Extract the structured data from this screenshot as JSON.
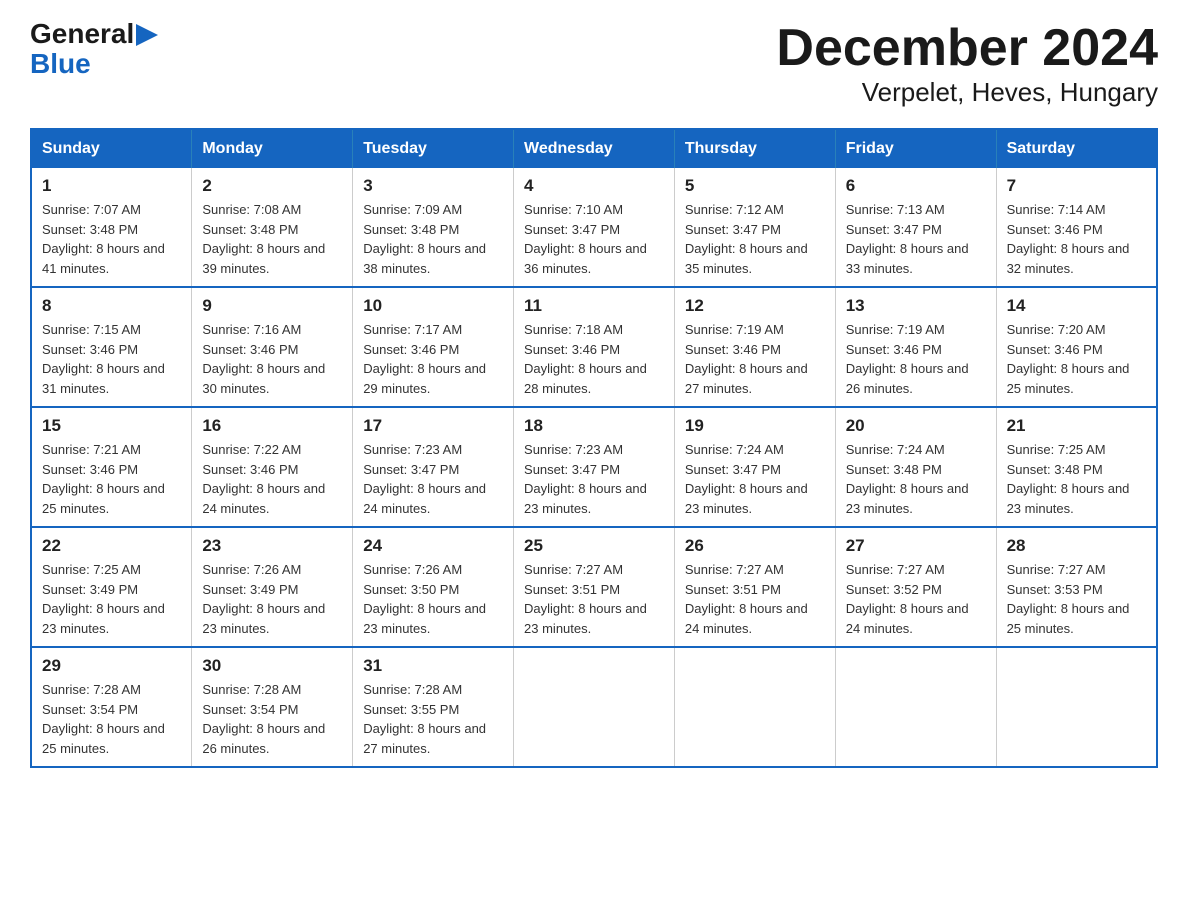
{
  "logo": {
    "general": "General",
    "arrow": "▶",
    "blue": "Blue"
  },
  "title": "December 2024",
  "subtitle": "Verpelet, Heves, Hungary",
  "weekdays": [
    "Sunday",
    "Monday",
    "Tuesday",
    "Wednesday",
    "Thursday",
    "Friday",
    "Saturday"
  ],
  "weeks": [
    [
      {
        "day": "1",
        "sunrise": "Sunrise: 7:07 AM",
        "sunset": "Sunset: 3:48 PM",
        "daylight": "Daylight: 8 hours and 41 minutes."
      },
      {
        "day": "2",
        "sunrise": "Sunrise: 7:08 AM",
        "sunset": "Sunset: 3:48 PM",
        "daylight": "Daylight: 8 hours and 39 minutes."
      },
      {
        "day": "3",
        "sunrise": "Sunrise: 7:09 AM",
        "sunset": "Sunset: 3:48 PM",
        "daylight": "Daylight: 8 hours and 38 minutes."
      },
      {
        "day": "4",
        "sunrise": "Sunrise: 7:10 AM",
        "sunset": "Sunset: 3:47 PM",
        "daylight": "Daylight: 8 hours and 36 minutes."
      },
      {
        "day": "5",
        "sunrise": "Sunrise: 7:12 AM",
        "sunset": "Sunset: 3:47 PM",
        "daylight": "Daylight: 8 hours and 35 minutes."
      },
      {
        "day": "6",
        "sunrise": "Sunrise: 7:13 AM",
        "sunset": "Sunset: 3:47 PM",
        "daylight": "Daylight: 8 hours and 33 minutes."
      },
      {
        "day": "7",
        "sunrise": "Sunrise: 7:14 AM",
        "sunset": "Sunset: 3:46 PM",
        "daylight": "Daylight: 8 hours and 32 minutes."
      }
    ],
    [
      {
        "day": "8",
        "sunrise": "Sunrise: 7:15 AM",
        "sunset": "Sunset: 3:46 PM",
        "daylight": "Daylight: 8 hours and 31 minutes."
      },
      {
        "day": "9",
        "sunrise": "Sunrise: 7:16 AM",
        "sunset": "Sunset: 3:46 PM",
        "daylight": "Daylight: 8 hours and 30 minutes."
      },
      {
        "day": "10",
        "sunrise": "Sunrise: 7:17 AM",
        "sunset": "Sunset: 3:46 PM",
        "daylight": "Daylight: 8 hours and 29 minutes."
      },
      {
        "day": "11",
        "sunrise": "Sunrise: 7:18 AM",
        "sunset": "Sunset: 3:46 PM",
        "daylight": "Daylight: 8 hours and 28 minutes."
      },
      {
        "day": "12",
        "sunrise": "Sunrise: 7:19 AM",
        "sunset": "Sunset: 3:46 PM",
        "daylight": "Daylight: 8 hours and 27 minutes."
      },
      {
        "day": "13",
        "sunrise": "Sunrise: 7:19 AM",
        "sunset": "Sunset: 3:46 PM",
        "daylight": "Daylight: 8 hours and 26 minutes."
      },
      {
        "day": "14",
        "sunrise": "Sunrise: 7:20 AM",
        "sunset": "Sunset: 3:46 PM",
        "daylight": "Daylight: 8 hours and 25 minutes."
      }
    ],
    [
      {
        "day": "15",
        "sunrise": "Sunrise: 7:21 AM",
        "sunset": "Sunset: 3:46 PM",
        "daylight": "Daylight: 8 hours and 25 minutes."
      },
      {
        "day": "16",
        "sunrise": "Sunrise: 7:22 AM",
        "sunset": "Sunset: 3:46 PM",
        "daylight": "Daylight: 8 hours and 24 minutes."
      },
      {
        "day": "17",
        "sunrise": "Sunrise: 7:23 AM",
        "sunset": "Sunset: 3:47 PM",
        "daylight": "Daylight: 8 hours and 24 minutes."
      },
      {
        "day": "18",
        "sunrise": "Sunrise: 7:23 AM",
        "sunset": "Sunset: 3:47 PM",
        "daylight": "Daylight: 8 hours and 23 minutes."
      },
      {
        "day": "19",
        "sunrise": "Sunrise: 7:24 AM",
        "sunset": "Sunset: 3:47 PM",
        "daylight": "Daylight: 8 hours and 23 minutes."
      },
      {
        "day": "20",
        "sunrise": "Sunrise: 7:24 AM",
        "sunset": "Sunset: 3:48 PM",
        "daylight": "Daylight: 8 hours and 23 minutes."
      },
      {
        "day": "21",
        "sunrise": "Sunrise: 7:25 AM",
        "sunset": "Sunset: 3:48 PM",
        "daylight": "Daylight: 8 hours and 23 minutes."
      }
    ],
    [
      {
        "day": "22",
        "sunrise": "Sunrise: 7:25 AM",
        "sunset": "Sunset: 3:49 PM",
        "daylight": "Daylight: 8 hours and 23 minutes."
      },
      {
        "day": "23",
        "sunrise": "Sunrise: 7:26 AM",
        "sunset": "Sunset: 3:49 PM",
        "daylight": "Daylight: 8 hours and 23 minutes."
      },
      {
        "day": "24",
        "sunrise": "Sunrise: 7:26 AM",
        "sunset": "Sunset: 3:50 PM",
        "daylight": "Daylight: 8 hours and 23 minutes."
      },
      {
        "day": "25",
        "sunrise": "Sunrise: 7:27 AM",
        "sunset": "Sunset: 3:51 PM",
        "daylight": "Daylight: 8 hours and 23 minutes."
      },
      {
        "day": "26",
        "sunrise": "Sunrise: 7:27 AM",
        "sunset": "Sunset: 3:51 PM",
        "daylight": "Daylight: 8 hours and 24 minutes."
      },
      {
        "day": "27",
        "sunrise": "Sunrise: 7:27 AM",
        "sunset": "Sunset: 3:52 PM",
        "daylight": "Daylight: 8 hours and 24 minutes."
      },
      {
        "day": "28",
        "sunrise": "Sunrise: 7:27 AM",
        "sunset": "Sunset: 3:53 PM",
        "daylight": "Daylight: 8 hours and 25 minutes."
      }
    ],
    [
      {
        "day": "29",
        "sunrise": "Sunrise: 7:28 AM",
        "sunset": "Sunset: 3:54 PM",
        "daylight": "Daylight: 8 hours and 25 minutes."
      },
      {
        "day": "30",
        "sunrise": "Sunrise: 7:28 AM",
        "sunset": "Sunset: 3:54 PM",
        "daylight": "Daylight: 8 hours and 26 minutes."
      },
      {
        "day": "31",
        "sunrise": "Sunrise: 7:28 AM",
        "sunset": "Sunset: 3:55 PM",
        "daylight": "Daylight: 8 hours and 27 minutes."
      },
      null,
      null,
      null,
      null
    ]
  ]
}
